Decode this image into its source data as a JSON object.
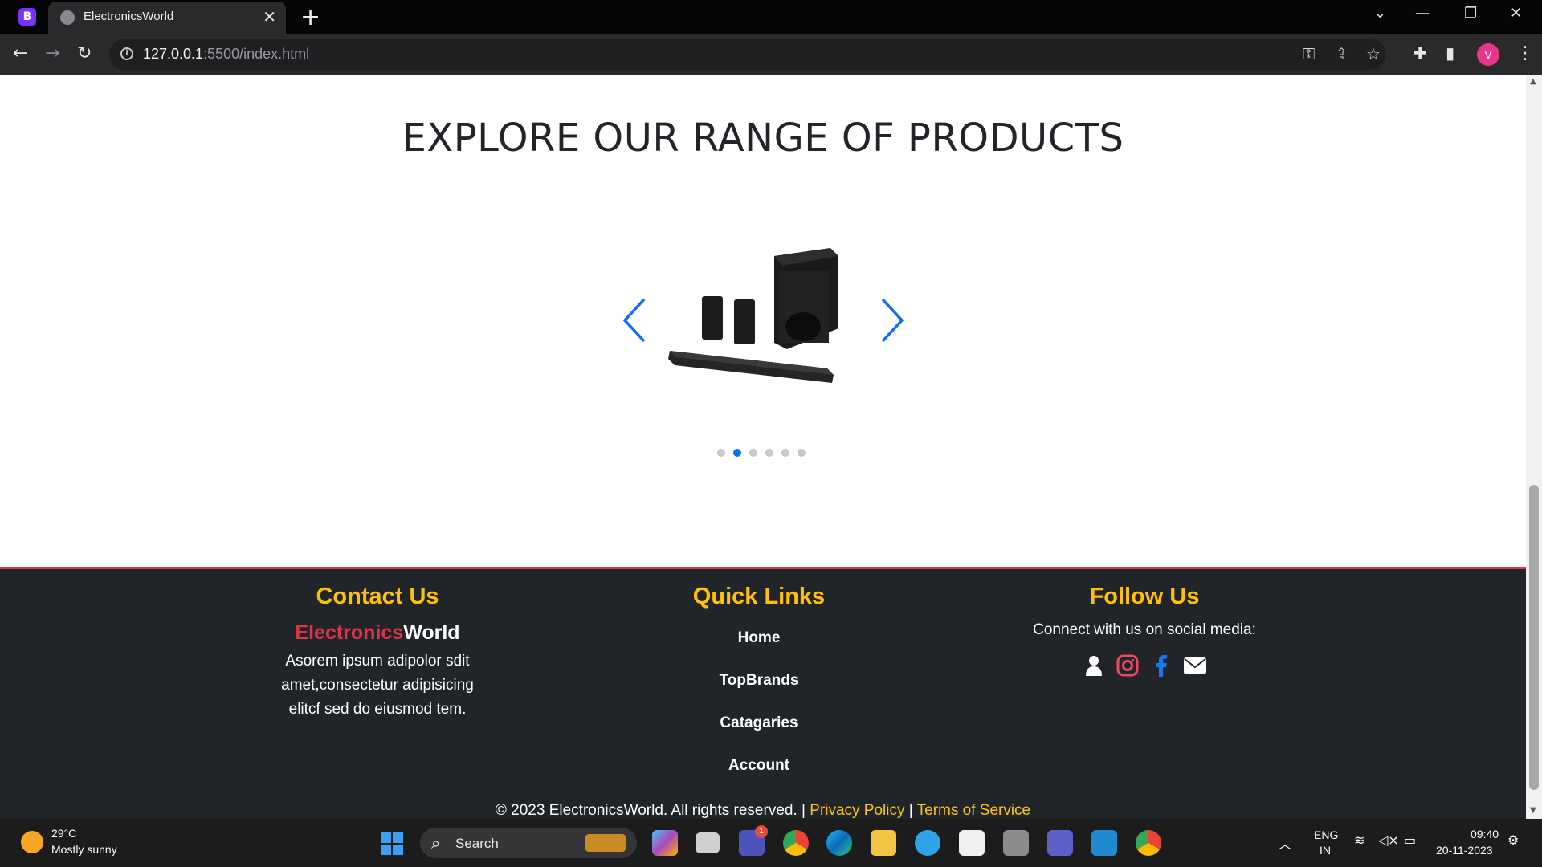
{
  "browser": {
    "app_badge": "B",
    "tab_title": "ElectronicsWorld",
    "tab_close": "✕",
    "new_tab": "+",
    "url_host": "127.0.0.1",
    "url_rest": ":5500/index.html",
    "profile_initial": "V",
    "window_controls": [
      "⌄",
      "—",
      "❐",
      "✕"
    ]
  },
  "page": {
    "headline": "EXPLORE OUR RANGE OF PRODUCTS",
    "carousel": {
      "slide_count": 6,
      "active_index": 1,
      "product_image": "home-theater-soundbar-with-subwoofer-and-rear-speakers"
    }
  },
  "footer": {
    "contact": {
      "title": "Contact Us",
      "brand_part1": "Electronics",
      "brand_part2": "World",
      "text": "Asorem ipsum adipolor sdit amet,consectetur adipisicing elitcf sed do eiusmod tem."
    },
    "quick_links": {
      "title": "Quick Links",
      "items": [
        "Home",
        "TopBrands",
        "Catagaries",
        "Account"
      ]
    },
    "follow": {
      "title": "Follow Us",
      "subtitle": "Connect with us on social media:",
      "icons": [
        "user-icon",
        "instagram-icon",
        "facebook-icon",
        "envelope-icon"
      ]
    },
    "copyright": "© 2023 ElectronicsWorld. All rights reserved. | ",
    "privacy": "Privacy Policy",
    "separator": " | ",
    "terms": "Terms of Service"
  },
  "taskbar": {
    "weather_temp": "29°C",
    "weather_desc": "Mostly sunny",
    "search_label": "Search",
    "teams_badge": "1",
    "lang_line1": "ENG",
    "lang_line2": "IN",
    "time": "09:40",
    "date": "20-11-2023"
  },
  "colors": {
    "accent_blue": "#0d6efd",
    "footer_bg": "#212529",
    "footer_heading": "#ffc107",
    "brand_red": "#dc3545"
  }
}
